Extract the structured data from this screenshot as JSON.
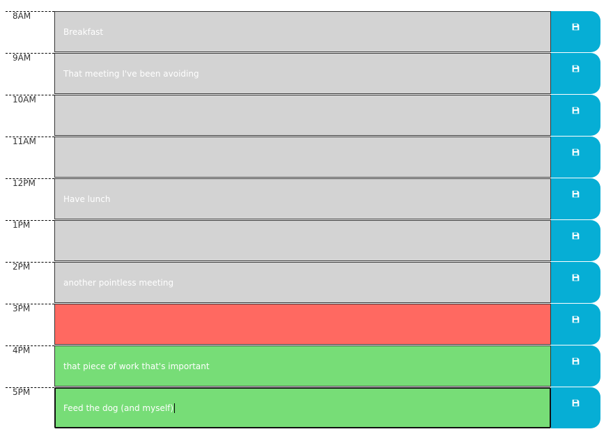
{
  "schedule": [
    {
      "hour": "8AM",
      "text": "Breakfast",
      "state": "past"
    },
    {
      "hour": "9AM",
      "text": "That meeting I've been avoiding",
      "state": "past"
    },
    {
      "hour": "10AM",
      "text": "",
      "state": "past"
    },
    {
      "hour": "11AM",
      "text": "",
      "state": "past"
    },
    {
      "hour": "12PM",
      "text": "Have lunch",
      "state": "past"
    },
    {
      "hour": "1PM",
      "text": "",
      "state": "past"
    },
    {
      "hour": "2PM",
      "text": "another pointless meeting",
      "state": "past"
    },
    {
      "hour": "3PM",
      "text": "",
      "state": "present"
    },
    {
      "hour": "4PM",
      "text": "that piece of work that's important",
      "state": "future"
    },
    {
      "hour": "5PM",
      "text": "Feed the dog (and myself)",
      "state": "future"
    }
  ],
  "colors": {
    "past": "#d3d3d3",
    "present": "#ff6961",
    "future": "#77dd77",
    "save_button": "#06aed5"
  },
  "icons": {
    "save": "floppy-disk-icon"
  }
}
